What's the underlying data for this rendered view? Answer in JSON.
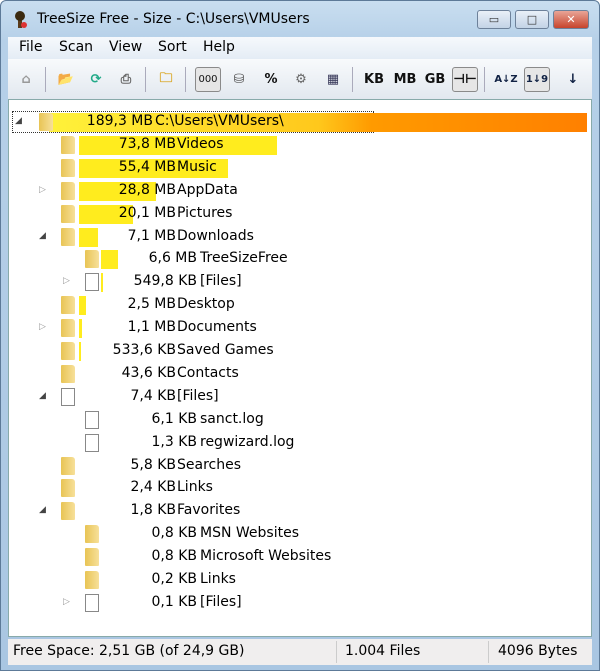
{
  "window": {
    "title": "TreeSize Free - Size - C:\\Users\\VMUsers",
    "minimize": "▭",
    "maximize": "□",
    "close": "✕"
  },
  "menu": [
    "File",
    "Scan",
    "View",
    "Sort",
    "Help"
  ],
  "toolbar": {
    "kb": "KB",
    "mb": "MB",
    "gb": "GB",
    "percent": "%",
    "digits": "000",
    "sort_az": "A↓Z",
    "sort_19": "1↓9",
    "arrow": "↓"
  },
  "tree": [
    {
      "size": "189,3 MB",
      "name": "C:\\Users\\VMUsers\\",
      "level": 0,
      "expander": "expanded",
      "icon": "folder",
      "share": 1.0
    },
    {
      "size": "73,8 MB",
      "name": "Videos",
      "level": 1,
      "expander": "none",
      "icon": "folder",
      "share": 0.39
    },
    {
      "size": "55,4 MB",
      "name": "Music",
      "level": 1,
      "expander": "none",
      "icon": "folder",
      "share": 0.293
    },
    {
      "size": "28,8 MB",
      "name": "AppData",
      "level": 1,
      "expander": "collapsed",
      "icon": "folder",
      "share": 0.152
    },
    {
      "size": "20,1 MB",
      "name": "Pictures",
      "level": 1,
      "expander": "none",
      "icon": "folder",
      "share": 0.106
    },
    {
      "size": "7,1 MB",
      "name": "Downloads",
      "level": 1,
      "expander": "expanded",
      "icon": "folder",
      "share": 0.0375
    },
    {
      "size": "6,6 MB",
      "name": "TreeSizeFree",
      "level": 2,
      "expander": "none",
      "icon": "folder",
      "share": 0.0349
    },
    {
      "size": "549,8 KB",
      "name": "[Files]",
      "level": 2,
      "expander": "collapsed",
      "icon": "file",
      "share": 0.0028
    },
    {
      "size": "2,5 MB",
      "name": "Desktop",
      "level": 1,
      "expander": "none",
      "icon": "folder",
      "share": 0.013
    },
    {
      "size": "1,1 MB",
      "name": "Documents",
      "level": 1,
      "expander": "collapsed",
      "icon": "folder",
      "share": 0.006
    },
    {
      "size": "533,6 KB",
      "name": "Saved Games",
      "level": 1,
      "expander": "none",
      "icon": "folder",
      "share": 0.003
    },
    {
      "size": "43,6 KB",
      "name": "Contacts",
      "level": 1,
      "expander": "none",
      "icon": "folder",
      "share": 0
    },
    {
      "size": "7,4 KB",
      "name": "[Files]",
      "level": 1,
      "expander": "expanded",
      "icon": "file",
      "share": 0
    },
    {
      "size": "6,1 KB",
      "name": "sanct.log",
      "level": 2,
      "expander": "none",
      "icon": "file",
      "share": 0
    },
    {
      "size": "1,3 KB",
      "name": "regwizard.log",
      "level": 2,
      "expander": "none",
      "icon": "file",
      "share": 0
    },
    {
      "size": "5,8 KB",
      "name": "Searches",
      "level": 1,
      "expander": "none",
      "icon": "folder",
      "share": 0
    },
    {
      "size": "2,4 KB",
      "name": "Links",
      "level": 1,
      "expander": "none",
      "icon": "folder",
      "share": 0
    },
    {
      "size": "1,8 KB",
      "name": "Favorites",
      "level": 1,
      "expander": "expanded",
      "icon": "folder",
      "share": 0
    },
    {
      "size": "0,8 KB",
      "name": "MSN Websites",
      "level": 2,
      "expander": "none",
      "icon": "folder",
      "share": 0
    },
    {
      "size": "0,8 KB",
      "name": "Microsoft Websites",
      "level": 2,
      "expander": "none",
      "icon": "folder",
      "share": 0
    },
    {
      "size": "0,2 KB",
      "name": "Links",
      "level": 2,
      "expander": "none",
      "icon": "folder",
      "share": 0
    },
    {
      "size": "0,1 KB",
      "name": "[Files]",
      "level": 2,
      "expander": "collapsed",
      "icon": "file",
      "share": 0
    }
  ],
  "status": {
    "free_space": "Free Space: 2,51 GB  (of 24,9 GB)",
    "files": "1.004  Files",
    "cluster": "4096 Bytes"
  },
  "colors": {
    "bar": "#ffec1e",
    "root_bar_end": "#ff8000"
  }
}
